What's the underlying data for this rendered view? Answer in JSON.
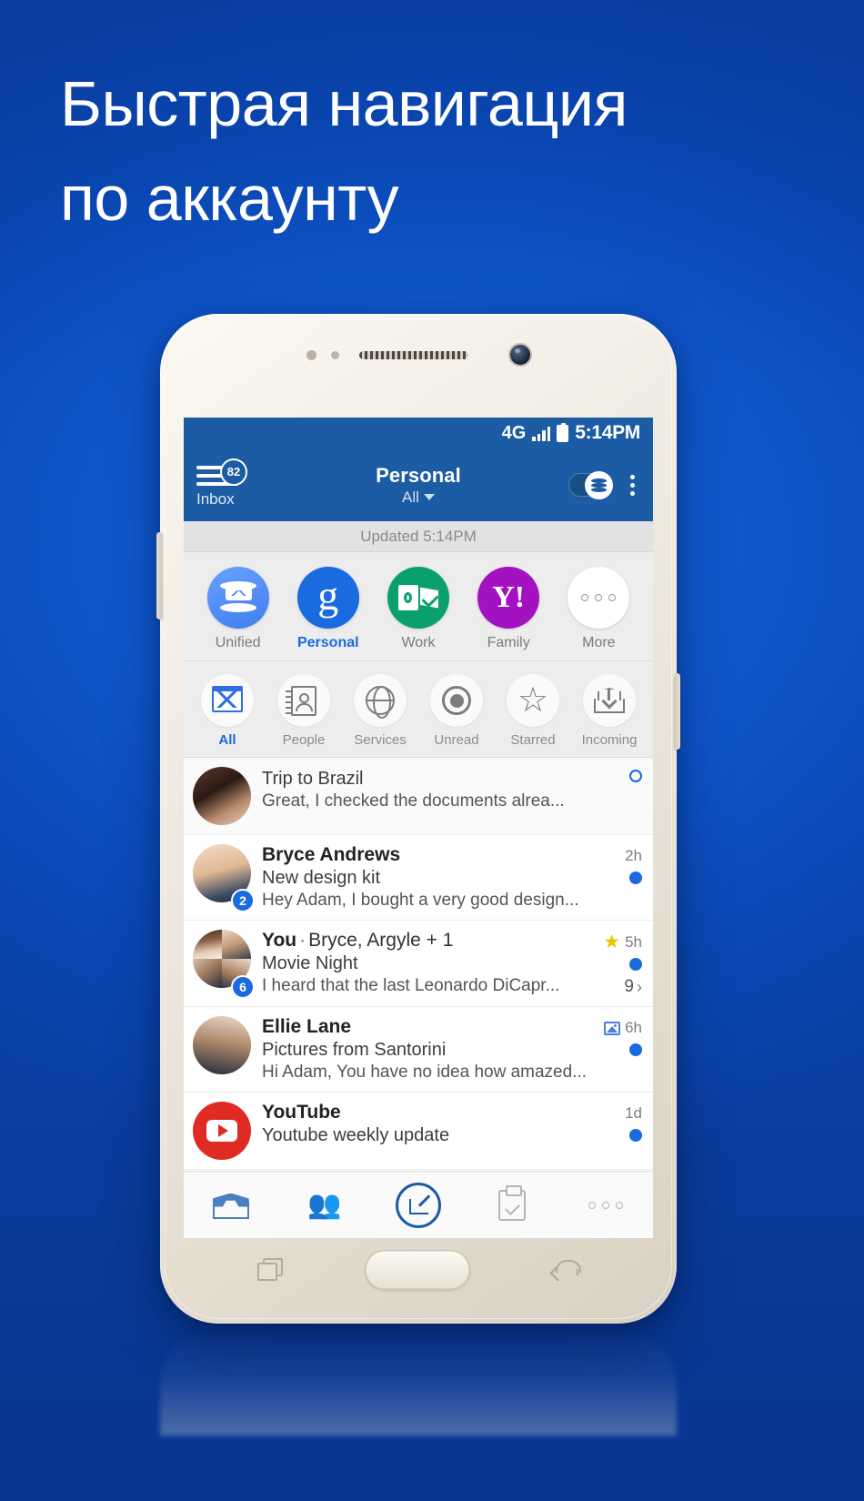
{
  "promo": {
    "headline": "Быстрая навигация\nпо аккаунту",
    "background_color": "#0b51c5",
    "headline_color": "#ffffff"
  },
  "statusbar": {
    "network": "4G",
    "signal_icon": "signal-bars-icon",
    "battery_icon": "battery-icon",
    "time": "5:14PM"
  },
  "appbar": {
    "menu_icon": "hamburger-menu-icon",
    "unread_badge": "82",
    "menu_label": "Inbox",
    "title": "Personal",
    "subtitle": "All",
    "subtitle_chevron": "chevron-down-icon",
    "toggle_icon": "unified-stack-toggle-icon",
    "overflow_icon": "kebab-menu-icon",
    "bar_color": "#1b5ca4"
  },
  "updated": {
    "text": "Updated 5:14PM"
  },
  "accounts": {
    "items": [
      {
        "label": "Unified",
        "icon": "unified-mail-icon",
        "active": false
      },
      {
        "label": "Personal",
        "icon": "google-icon",
        "active": true
      },
      {
        "label": "Work",
        "icon": "outlook-icon",
        "active": false
      },
      {
        "label": "Family",
        "icon": "yahoo-icon",
        "active": false
      },
      {
        "label": "More",
        "icon": "more-dots-icon",
        "active": false
      }
    ],
    "active_color": "#1a6ae0"
  },
  "filters": {
    "items": [
      {
        "label": "All",
        "icon": "envelope-icon",
        "active": true
      },
      {
        "label": "People",
        "icon": "contacts-book-icon",
        "active": false
      },
      {
        "label": "Services",
        "icon": "globe-icon",
        "active": false
      },
      {
        "label": "Unread",
        "icon": "unread-dot-icon",
        "active": false
      },
      {
        "label": "Starred",
        "icon": "star-outline-icon",
        "active": false
      },
      {
        "label": "Incoming",
        "icon": "inbox-download-icon",
        "active": false
      }
    ]
  },
  "mail": {
    "rows": [
      {
        "from": "",
        "subject": "Trip to Brazil",
        "preview": "Great, I checked the documents alrea...",
        "time": "",
        "badge": "",
        "starred": false,
        "has_attachment": false,
        "unread_style": "hollow",
        "thread_count": "",
        "avatar": "photo-couple"
      },
      {
        "from": "Bryce Andrews",
        "subject": "New design kit",
        "preview": "Hey Adam, I bought a very good design...",
        "time": "2h",
        "badge": "2",
        "starred": false,
        "has_attachment": false,
        "unread_style": "filled",
        "thread_count": "",
        "avatar": "photo-man"
      },
      {
        "from_you": "You",
        "from_sep": "·",
        "from_others": "Bryce, Argyle + 1",
        "subject": "Movie Night",
        "preview": "I heard that the last Leonardo DiCapr...",
        "time": "5h",
        "badge": "6",
        "starred": true,
        "has_attachment": false,
        "unread_style": "filled",
        "thread_count": "9",
        "thread_arrow": "›",
        "avatar": "photo-group"
      },
      {
        "from": "Ellie Lane",
        "subject": "Pictures from Santorini",
        "preview": "Hi Adam, You have no idea how amazed...",
        "time": "6h",
        "badge": "",
        "starred": false,
        "has_attachment": true,
        "unread_style": "filled",
        "thread_count": "",
        "avatar": "photo-woman"
      },
      {
        "from": "YouTube",
        "subject": "Youtube weekly update",
        "preview": "",
        "time": "1d",
        "badge": "",
        "starred": false,
        "has_attachment": false,
        "unread_style": "filled",
        "thread_count": "",
        "avatar": "youtube-logo"
      }
    ]
  },
  "tabs": {
    "items": [
      {
        "icon": "inbox-tab-icon",
        "active": true
      },
      {
        "icon": "people-tab-icon",
        "active": false
      },
      {
        "icon": "compose-tab-icon",
        "active": true
      },
      {
        "icon": "tasks-tab-icon",
        "active": false
      },
      {
        "icon": "more-tab-icon",
        "active": false
      }
    ]
  },
  "device": {
    "recents_key": "recents-key",
    "home_key": "home-key",
    "back_key": "back-key"
  }
}
